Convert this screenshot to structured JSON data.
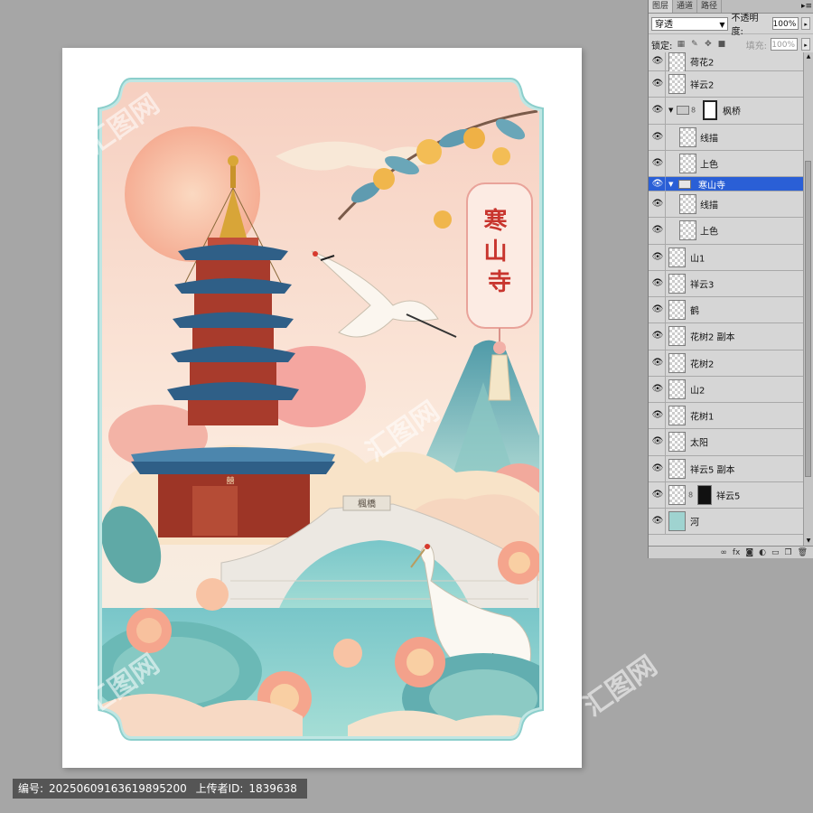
{
  "artwork": {
    "plaque_text": "寒山寺",
    "bridge_sign": "楓橋",
    "gate_sign": "囍",
    "watermark_text": "汇图网"
  },
  "footer": {
    "id_label": "编号:",
    "id_value": "20250609163619895200",
    "uploader_label": "上传者ID:",
    "uploader_value": "1839638"
  },
  "panel": {
    "tabs": [
      "图层",
      "通道",
      "路径"
    ],
    "blend_mode": "穿透",
    "opacity_label": "不透明度:",
    "opacity_value": "100%",
    "lock_label": "锁定:",
    "fill_label": "填充:",
    "fill_value": "100%",
    "layers": [
      {
        "name": "荷花2"
      },
      {
        "name": "祥云2"
      },
      {
        "name": "枫桥"
      },
      {
        "name": "线描"
      },
      {
        "name": "上色"
      },
      {
        "name": "寒山寺"
      },
      {
        "name": "线描"
      },
      {
        "name": "上色"
      },
      {
        "name": "山1"
      },
      {
        "name": "祥云3"
      },
      {
        "name": "鹤"
      },
      {
        "name": "花树2 副本"
      },
      {
        "name": "花树2"
      },
      {
        "name": "山2"
      },
      {
        "name": "花树1"
      },
      {
        "name": "太阳"
      },
      {
        "name": "祥云5 副本"
      },
      {
        "name": "祥云5"
      },
      {
        "name": "河"
      }
    ]
  },
  "colors": {
    "panel_bg": "#d6d6d6",
    "selected": "#2a5fd6",
    "frame_teal": "#9fd8d6",
    "sky_peach": "#f8d8c8",
    "plaque_red": "#c8352e"
  }
}
